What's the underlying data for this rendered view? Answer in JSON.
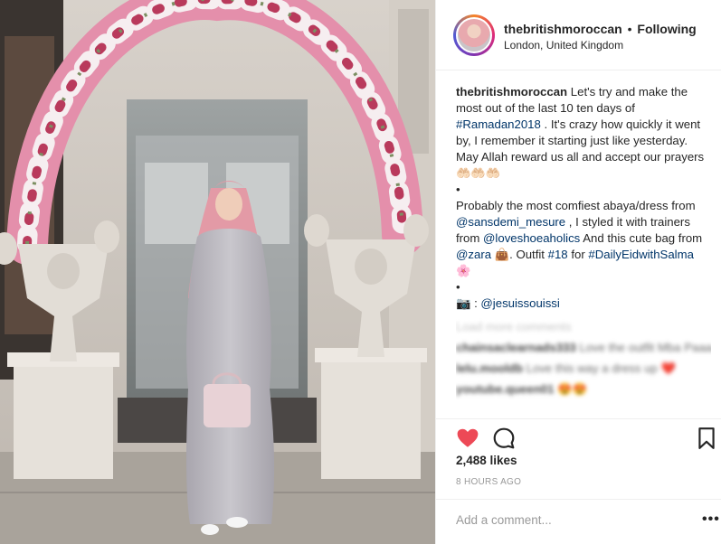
{
  "post": {
    "username": "thebritishmoroccan",
    "follow_label": "Following",
    "location": "London, United Kingdom"
  },
  "caption": {
    "username": "thebritishmoroccan",
    "text_1": " Let's try and make the most out of the last 10 ten days of ",
    "hashtag_ramadan": "#Ramadan2018",
    "text_2": " . It's crazy how quickly it went by, I remember it starting just like yesterday. May Allah reward us all and accept our prayers 🤲🏻🤲🏻🤲🏻",
    "bullet": "•",
    "text_3": "Probably the most comfiest abaya/dress from ",
    "mention_sansdemi": "@sansdemi_mesure",
    "text_4": " , I styled it with trainers from ",
    "mention_loveshoe": "@loveshoeaholics",
    "text_5": " And this cute bag from ",
    "mention_zara": "@zara",
    "text_6": " 👜. Outfit ",
    "hashtag_18": "#18",
    "text_7": " for ",
    "hashtag_eid": "#DailyEidwithSalma",
    "text_8": " 🌸",
    "bullet_2": "•",
    "credit_prefix": "📷 : ",
    "mention_jesuis": "@jesuissouissi"
  },
  "comments": {
    "load_more": "Load more comments",
    "items": [
      {
        "user": "chainsaclearnads333",
        "text": "Love the outfit Mba Paaaaru 😍"
      },
      {
        "user": "lelu.mooldb",
        "text": "Love this way a dress up ❤️"
      },
      {
        "user": "youtube.queen01",
        "text": "😍😍"
      }
    ]
  },
  "likes": "2,488 likes",
  "timestamp": "8 HOURS AGO",
  "add_comment_placeholder": "Add a comment...",
  "more_label": "•••",
  "colors": {
    "heart": "#ed4956",
    "link": "#003569",
    "text": "#262626",
    "muted": "#999999"
  },
  "icons": [
    "heart-filled-icon",
    "comment-icon",
    "bookmark-icon",
    "more-options-icon"
  ]
}
